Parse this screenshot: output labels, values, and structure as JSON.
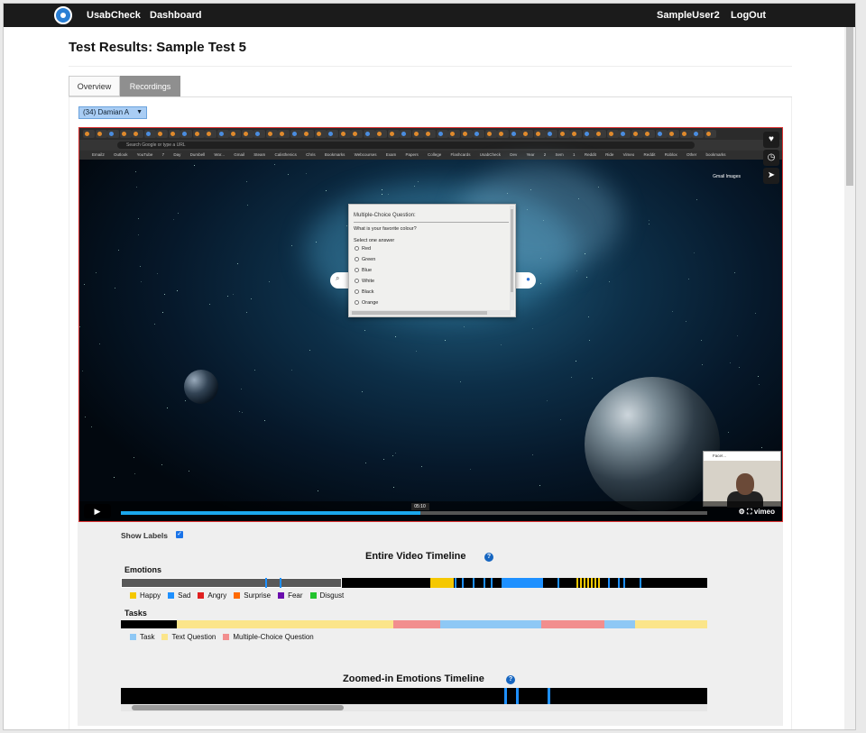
{
  "navbar": {
    "brand": "UsabCheck",
    "dashboard": "Dashboard",
    "user": "SampleUser2",
    "logout": "LogOut"
  },
  "page": {
    "title": "Test Results: Sample Test 5"
  },
  "tabs": [
    "Overview",
    "Recordings"
  ],
  "participant_select": {
    "selected": "(34) Damian A"
  },
  "video": {
    "address_placeholder": "Search Google or type a URL",
    "bookmarks": "Email2 Outlook YouTube 7 Day Dumbell Wor... Gmail Steam Calisthenics Chris Bookmarks Webcourses Exam Papers College Flashcards UsabCheck Dev Year 2 Sem 1 Reddit Ride Vimeo Reddit Roblox Other bookmarks",
    "gmail_links": "Gmail   Images",
    "search_icon": "search-icon",
    "mic_icon": "microphone-icon",
    "time_tooltip": "05:10",
    "progress_fraction": 0.51,
    "webcam_title": "Face!...",
    "player_brand": "vimeo",
    "side_icons": [
      "heart-icon",
      "clock-icon",
      "send-icon"
    ]
  },
  "mcq": {
    "title": "Multiple-Choice Question:",
    "question": "What is your favorite colour?",
    "instruction": "Select one answer",
    "options": [
      "Red",
      "Green",
      "Blue",
      "White",
      "Black",
      "Orange"
    ]
  },
  "show_labels": {
    "label": "Show Labels",
    "checked": true
  },
  "entire_timeline": {
    "title": "Entire Video Timeline",
    "emotions_label": "Emotions",
    "tasks_label": "Tasks"
  },
  "emotion_legend": [
    {
      "label": "Happy",
      "color": "#f5c800"
    },
    {
      "label": "Sad",
      "color": "#1e90ff"
    },
    {
      "label": "Angry",
      "color": "#e02020"
    },
    {
      "label": "Surprise",
      "color": "#ff6a00"
    },
    {
      "label": "Fear",
      "color": "#6a0dad"
    },
    {
      "label": "Disgust",
      "color": "#22c32e"
    }
  ],
  "task_legend": [
    {
      "label": "Task",
      "color": "#8ec8f5"
    },
    {
      "label": "Text Question",
      "color": "#fbe58a"
    },
    {
      "label": "Multiple-Choice Question",
      "color": "#f28e8e"
    }
  ],
  "zoomed_timeline": {
    "title": "Zoomed-in Emotions Timeline"
  }
}
